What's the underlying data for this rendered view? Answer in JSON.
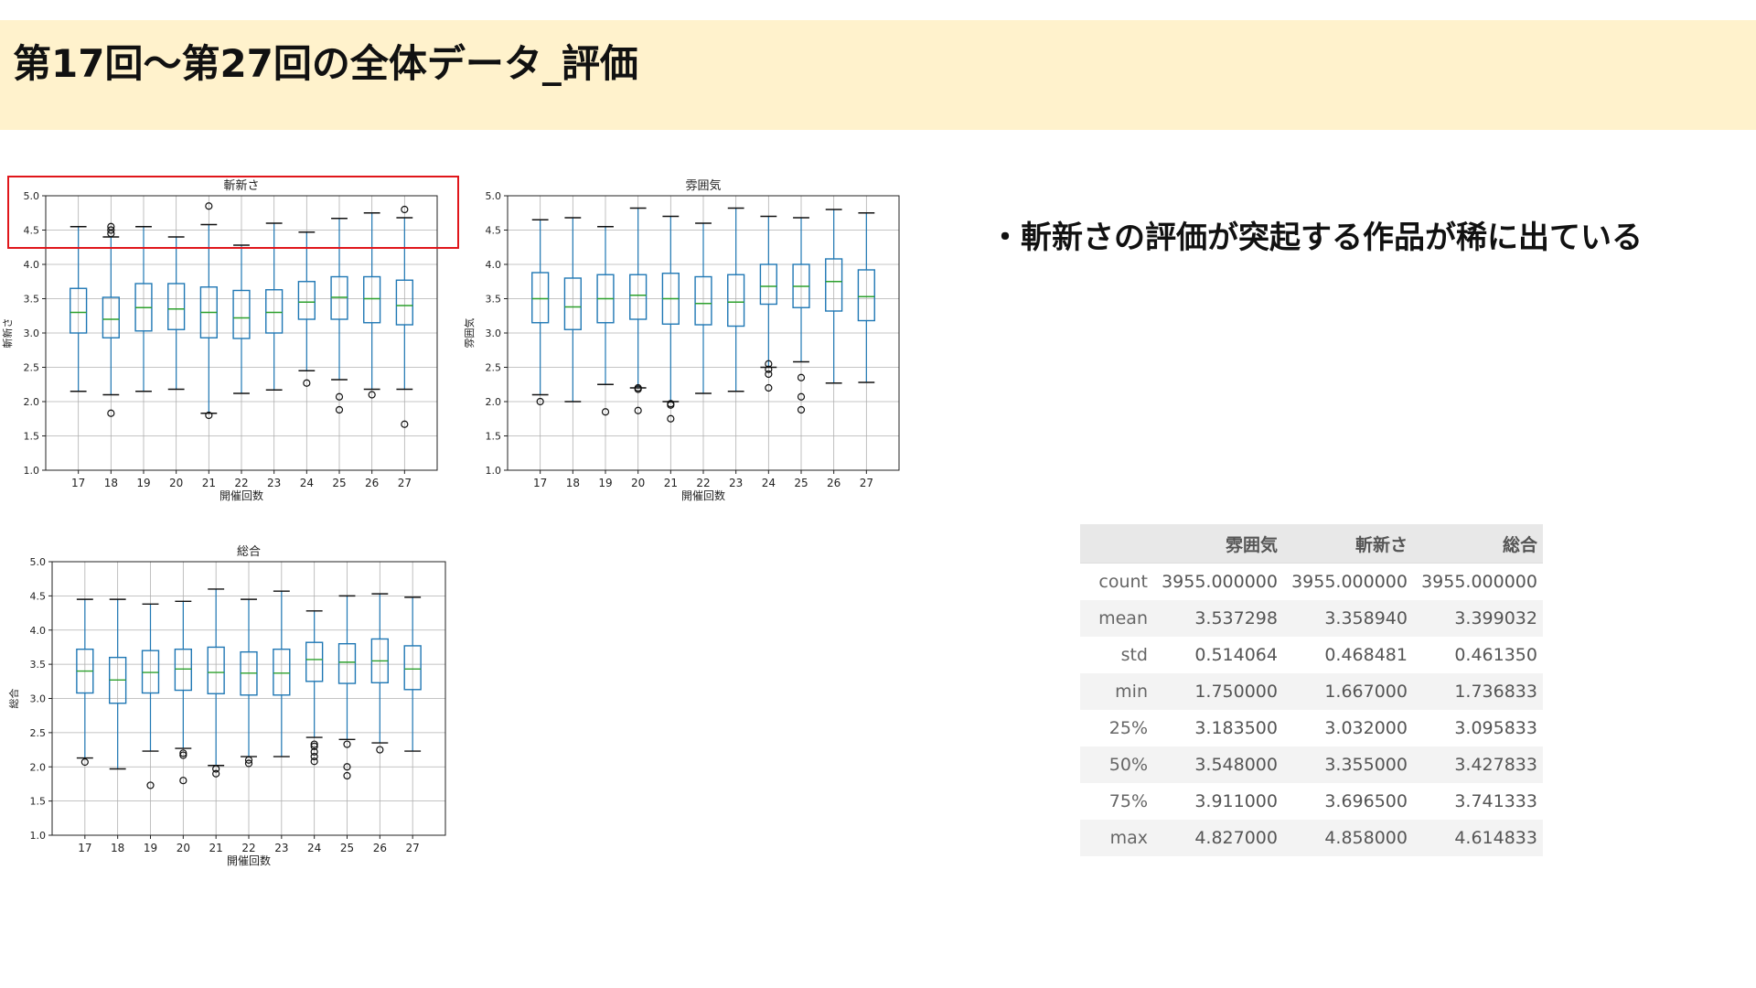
{
  "slide": {
    "title": "第17回〜第27回の全体データ_評価",
    "bullet": "・斬新さの評価が突起する作品が稀に出ている"
  },
  "colors": {
    "header_bg": "#fff2cc",
    "box": "#1f77b4",
    "median": "#2ca02c",
    "highlight": "#e0161b"
  },
  "chart_data": [
    {
      "type": "box",
      "title": "斬新さ",
      "xlabel": "開催回数",
      "ylabel": "斬新さ",
      "ylim": [
        1.0,
        5.0
      ],
      "yticks": [
        "1.0",
        "1.5",
        "2.0",
        "2.5",
        "3.0",
        "3.5",
        "4.0",
        "4.5",
        "5.0"
      ],
      "grid": true,
      "categories": [
        "17",
        "18",
        "19",
        "20",
        "21",
        "22",
        "23",
        "24",
        "25",
        "26",
        "27"
      ],
      "boxes": [
        {
          "wlo": 2.15,
          "q1": 3.0,
          "med": 3.3,
          "q3": 3.65,
          "whi": 4.55,
          "out": []
        },
        {
          "wlo": 2.1,
          "q1": 2.93,
          "med": 3.2,
          "q3": 3.52,
          "whi": 4.4,
          "out": [
            1.83,
            4.45,
            4.5,
            4.55
          ]
        },
        {
          "wlo": 2.15,
          "q1": 3.03,
          "med": 3.37,
          "q3": 3.72,
          "whi": 4.55,
          "out": []
        },
        {
          "wlo": 2.18,
          "q1": 3.05,
          "med": 3.35,
          "q3": 3.72,
          "whi": 4.4,
          "out": []
        },
        {
          "wlo": 1.83,
          "q1": 2.93,
          "med": 3.3,
          "q3": 3.67,
          "whi": 4.58,
          "out": [
            1.8,
            4.85
          ]
        },
        {
          "wlo": 2.12,
          "q1": 2.92,
          "med": 3.22,
          "q3": 3.62,
          "whi": 4.28,
          "out": []
        },
        {
          "wlo": 2.17,
          "q1": 3.0,
          "med": 3.3,
          "q3": 3.63,
          "whi": 4.6,
          "out": []
        },
        {
          "wlo": 2.45,
          "q1": 3.2,
          "med": 3.45,
          "q3": 3.75,
          "whi": 4.47,
          "out": [
            2.27
          ]
        },
        {
          "wlo": 2.32,
          "q1": 3.2,
          "med": 3.52,
          "q3": 3.82,
          "whi": 4.67,
          "out": [
            2.07,
            1.88
          ]
        },
        {
          "wlo": 2.18,
          "q1": 3.15,
          "med": 3.5,
          "q3": 3.82,
          "whi": 4.75,
          "out": [
            2.1
          ]
        },
        {
          "wlo": 2.18,
          "q1": 3.12,
          "med": 3.4,
          "q3": 3.77,
          "whi": 4.68,
          "out": [
            1.67,
            4.8
          ]
        }
      ]
    },
    {
      "type": "box",
      "title": "雰囲気",
      "xlabel": "開催回数",
      "ylabel": "雰囲気",
      "ylim": [
        1.0,
        5.0
      ],
      "yticks": [
        "1.0",
        "1.5",
        "2.0",
        "2.5",
        "3.0",
        "3.5",
        "4.0",
        "4.5",
        "5.0"
      ],
      "grid": true,
      "categories": [
        "17",
        "18",
        "19",
        "20",
        "21",
        "22",
        "23",
        "24",
        "25",
        "26",
        "27"
      ],
      "boxes": [
        {
          "wlo": 2.1,
          "q1": 3.15,
          "med": 3.5,
          "q3": 3.88,
          "whi": 4.65,
          "out": [
            2.0
          ]
        },
        {
          "wlo": 2.0,
          "q1": 3.05,
          "med": 3.38,
          "q3": 3.8,
          "whi": 4.68,
          "out": []
        },
        {
          "wlo": 2.25,
          "q1": 3.15,
          "med": 3.5,
          "q3": 3.85,
          "whi": 4.55,
          "out": [
            1.85
          ]
        },
        {
          "wlo": 2.2,
          "q1": 3.2,
          "med": 3.55,
          "q3": 3.85,
          "whi": 4.82,
          "out": [
            2.2,
            2.18,
            1.87
          ]
        },
        {
          "wlo": 2.0,
          "q1": 3.13,
          "med": 3.5,
          "q3": 3.87,
          "whi": 4.7,
          "out": [
            1.97,
            1.95,
            1.75
          ]
        },
        {
          "wlo": 2.12,
          "q1": 3.12,
          "med": 3.43,
          "q3": 3.82,
          "whi": 4.6,
          "out": []
        },
        {
          "wlo": 2.15,
          "q1": 3.1,
          "med": 3.45,
          "q3": 3.85,
          "whi": 4.82,
          "out": []
        },
        {
          "wlo": 2.5,
          "q1": 3.42,
          "med": 3.68,
          "q3": 4.0,
          "whi": 4.7,
          "out": [
            2.55,
            2.47,
            2.4,
            2.2
          ]
        },
        {
          "wlo": 2.58,
          "q1": 3.37,
          "med": 3.68,
          "q3": 4.0,
          "whi": 4.68,
          "out": [
            2.35,
            2.07,
            1.88
          ]
        },
        {
          "wlo": 2.27,
          "q1": 3.32,
          "med": 3.75,
          "q3": 4.08,
          "whi": 4.8,
          "out": []
        },
        {
          "wlo": 2.28,
          "q1": 3.18,
          "med": 3.53,
          "q3": 3.92,
          "whi": 4.75,
          "out": []
        }
      ]
    },
    {
      "type": "box",
      "title": "総合",
      "xlabel": "開催回数",
      "ylabel": "総合",
      "ylim": [
        1.0,
        5.0
      ],
      "yticks": [
        "1.0",
        "1.5",
        "2.0",
        "2.5",
        "3.0",
        "3.5",
        "4.0",
        "4.5",
        "5.0"
      ],
      "grid": true,
      "categories": [
        "17",
        "18",
        "19",
        "20",
        "21",
        "22",
        "23",
        "24",
        "25",
        "26",
        "27"
      ],
      "boxes": [
        {
          "wlo": 2.13,
          "q1": 3.08,
          "med": 3.4,
          "q3": 3.72,
          "whi": 4.45,
          "out": [
            2.07
          ]
        },
        {
          "wlo": 1.97,
          "q1": 2.93,
          "med": 3.27,
          "q3": 3.6,
          "whi": 4.45,
          "out": []
        },
        {
          "wlo": 2.23,
          "q1": 3.08,
          "med": 3.38,
          "q3": 3.7,
          "whi": 4.38,
          "out": [
            1.73
          ]
        },
        {
          "wlo": 2.27,
          "q1": 3.12,
          "med": 3.43,
          "q3": 3.72,
          "whi": 4.42,
          "out": [
            2.2,
            2.17,
            1.8
          ]
        },
        {
          "wlo": 2.02,
          "q1": 3.07,
          "med": 3.38,
          "q3": 3.75,
          "whi": 4.6,
          "out": [
            1.97,
            1.9
          ]
        },
        {
          "wlo": 2.15,
          "q1": 3.05,
          "med": 3.37,
          "q3": 3.68,
          "whi": 4.45,
          "out": [
            2.1,
            2.05
          ]
        },
        {
          "wlo": 2.15,
          "q1": 3.05,
          "med": 3.37,
          "q3": 3.72,
          "whi": 4.57,
          "out": []
        },
        {
          "wlo": 2.43,
          "q1": 3.25,
          "med": 3.57,
          "q3": 3.82,
          "whi": 4.28,
          "out": [
            2.33,
            2.3,
            2.22,
            2.15,
            2.08
          ]
        },
        {
          "wlo": 2.4,
          "q1": 3.22,
          "med": 3.53,
          "q3": 3.8,
          "whi": 4.5,
          "out": [
            2.33,
            2.0,
            1.87
          ]
        },
        {
          "wlo": 2.35,
          "q1": 3.23,
          "med": 3.55,
          "q3": 3.87,
          "whi": 4.53,
          "out": [
            2.25
          ]
        },
        {
          "wlo": 2.23,
          "q1": 3.13,
          "med": 3.43,
          "q3": 3.77,
          "whi": 4.48,
          "out": []
        }
      ]
    },
    {
      "type": "table",
      "columns": [
        "",
        "雰囲気",
        "斬新さ",
        "総合"
      ],
      "rows": [
        [
          "count",
          "3955.000000",
          "3955.000000",
          "3955.000000"
        ],
        [
          "mean",
          "3.537298",
          "3.358940",
          "3.399032"
        ],
        [
          "std",
          "0.514064",
          "0.468481",
          "0.461350"
        ],
        [
          "min",
          "1.750000",
          "1.667000",
          "1.736833"
        ],
        [
          "25%",
          "3.183500",
          "3.032000",
          "3.095833"
        ],
        [
          "50%",
          "3.548000",
          "3.355000",
          "3.427833"
        ],
        [
          "75%",
          "3.911000",
          "3.696500",
          "3.741333"
        ],
        [
          "max",
          "4.827000",
          "4.858000",
          "4.614833"
        ]
      ]
    }
  ]
}
